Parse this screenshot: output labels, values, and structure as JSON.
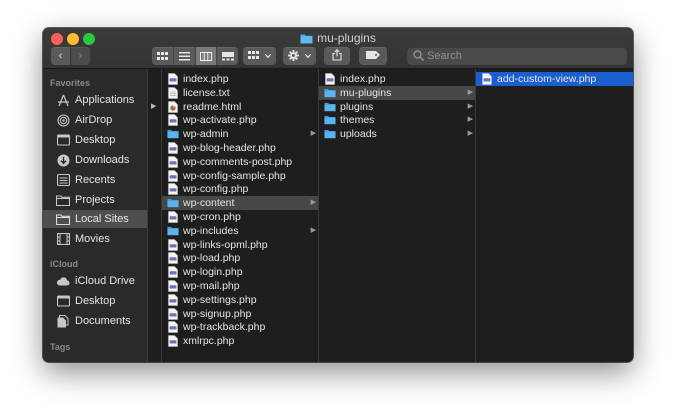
{
  "window": {
    "title": "mu-plugins"
  },
  "toolbar": {
    "back": "‹",
    "forward": "›",
    "search_placeholder": "Search"
  },
  "sidebar": {
    "favorites_header": "Favorites",
    "favorites": [
      {
        "label": "Applications",
        "icon": "applications-icon"
      },
      {
        "label": "AirDrop",
        "icon": "airdrop-icon"
      },
      {
        "label": "Desktop",
        "icon": "desktop-icon"
      },
      {
        "label": "Downloads",
        "icon": "downloads-icon"
      },
      {
        "label": "Recents",
        "icon": "recents-icon"
      },
      {
        "label": "Projects",
        "icon": "folder-icon"
      },
      {
        "label": "Local Sites",
        "icon": "folder-icon",
        "selected": true
      },
      {
        "label": "Movies",
        "icon": "movies-icon"
      }
    ],
    "icloud_header": "iCloud",
    "icloud": [
      {
        "label": "iCloud Drive",
        "icon": "cloud-icon"
      },
      {
        "label": "Desktop",
        "icon": "desktop-icon"
      },
      {
        "label": "Documents",
        "icon": "documents-icon"
      }
    ],
    "tags_header": "Tags"
  },
  "columns": {
    "col2": [
      {
        "name": "index.php",
        "type": "php"
      },
      {
        "name": "license.txt",
        "type": "txt"
      },
      {
        "name": "readme.html",
        "type": "html"
      },
      {
        "name": "wp-activate.php",
        "type": "php"
      },
      {
        "name": "wp-admin",
        "type": "folder"
      },
      {
        "name": "wp-blog-header.php",
        "type": "php"
      },
      {
        "name": "wp-comments-post.php",
        "type": "php"
      },
      {
        "name": "wp-config-sample.php",
        "type": "php"
      },
      {
        "name": "wp-config.php",
        "type": "php"
      },
      {
        "name": "wp-content",
        "type": "folder",
        "selected": true
      },
      {
        "name": "wp-cron.php",
        "type": "php"
      },
      {
        "name": "wp-includes",
        "type": "folder"
      },
      {
        "name": "wp-links-opml.php",
        "type": "php"
      },
      {
        "name": "wp-load.php",
        "type": "php"
      },
      {
        "name": "wp-login.php",
        "type": "php"
      },
      {
        "name": "wp-mail.php",
        "type": "php"
      },
      {
        "name": "wp-settings.php",
        "type": "php"
      },
      {
        "name": "wp-signup.php",
        "type": "php"
      },
      {
        "name": "wp-trackback.php",
        "type": "php"
      },
      {
        "name": "xmlrpc.php",
        "type": "php"
      }
    ],
    "col3": [
      {
        "name": "index.php",
        "type": "php"
      },
      {
        "name": "mu-plugins",
        "type": "folder",
        "selected": true
      },
      {
        "name": "plugins",
        "type": "folder"
      },
      {
        "name": "themes",
        "type": "folder"
      },
      {
        "name": "uploads",
        "type": "folder"
      }
    ],
    "col4": [
      {
        "name": "add-custom-view.php",
        "type": "php",
        "active": true
      }
    ]
  },
  "colors": {
    "selection_blue": "#1a5fd0",
    "folder_blue": "#4aa8e6"
  }
}
